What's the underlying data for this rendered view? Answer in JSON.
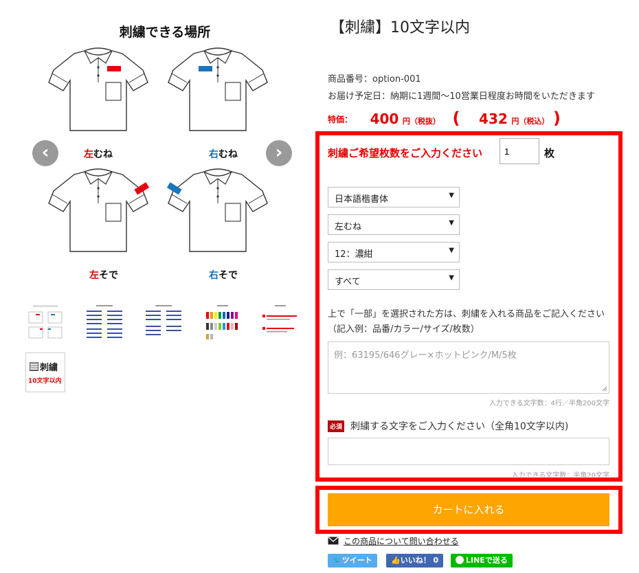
{
  "gallery": {
    "title": "刺繍できる場所",
    "prev_icon": "chevron-left-icon",
    "next_icon": "chevron-right-icon",
    "prev_glyph": "‹",
    "next_glyph": "›",
    "shirts": [
      {
        "prefix": "左",
        "suffix": "むね",
        "prefix_color": "#d40000"
      },
      {
        "prefix": "右",
        "suffix": "むね",
        "prefix_color": "#1570b8"
      },
      {
        "prefix": "左",
        "suffix": "そで",
        "prefix_color": "#d40000"
      },
      {
        "prefix": "右",
        "suffix": "そで",
        "prefix_color": "#1570b8"
      }
    ],
    "badge": {
      "line1": "刺繍",
      "line2": "10文字以内"
    },
    "colors": {
      "red": "#e60012",
      "blue": "#1b75bc"
    }
  },
  "product": {
    "title": "【刺繍】10文字以内",
    "code": "商品番号：option-001",
    "delivery": "お届け予定日：納期に1週間～10営業日程度お時間をいただきます",
    "price": {
      "special_label": "特価：",
      "excl": "400",
      "excl_unit": "円（税抜）",
      "paren_open": "(",
      "incl": "432",
      "incl_unit": "円（税込）",
      "paren_close": ")"
    }
  },
  "form": {
    "qty_label": "刺繍ご希望枚数をご入力ください",
    "qty_value": "1",
    "qty_unit": "枚",
    "selects": [
      {
        "value": "日本語楷書体"
      },
      {
        "value": "左むね"
      },
      {
        "value": "12：濃紺"
      },
      {
        "value": "すべて"
      }
    ],
    "note": "上で「一部」を選択された方は、刺繍を入れる商品をご記入ください（記入例：品番/カラー/サイズ/枚数）",
    "textarea_placeholder": "例：63195/646グレー×ホットピンク/M/5枚",
    "textarea_counter": "入力できる文字数：4行／半角200文字",
    "required_badge": "必須",
    "embroidery_label": "刺繍する文字をご入力ください（全角10文字以内)",
    "text_counter": "入力できる文字数：半角20文字",
    "cart_button": "カートに入れる"
  },
  "footer": {
    "inquiry": "この商品について問い合わせる",
    "tweet": "ツイート",
    "like": "いいね！ 0",
    "line": "LINEで送る",
    "colors": {
      "twitter": "#55acee",
      "facebook": "#4267b2",
      "line": "#00b900"
    }
  }
}
